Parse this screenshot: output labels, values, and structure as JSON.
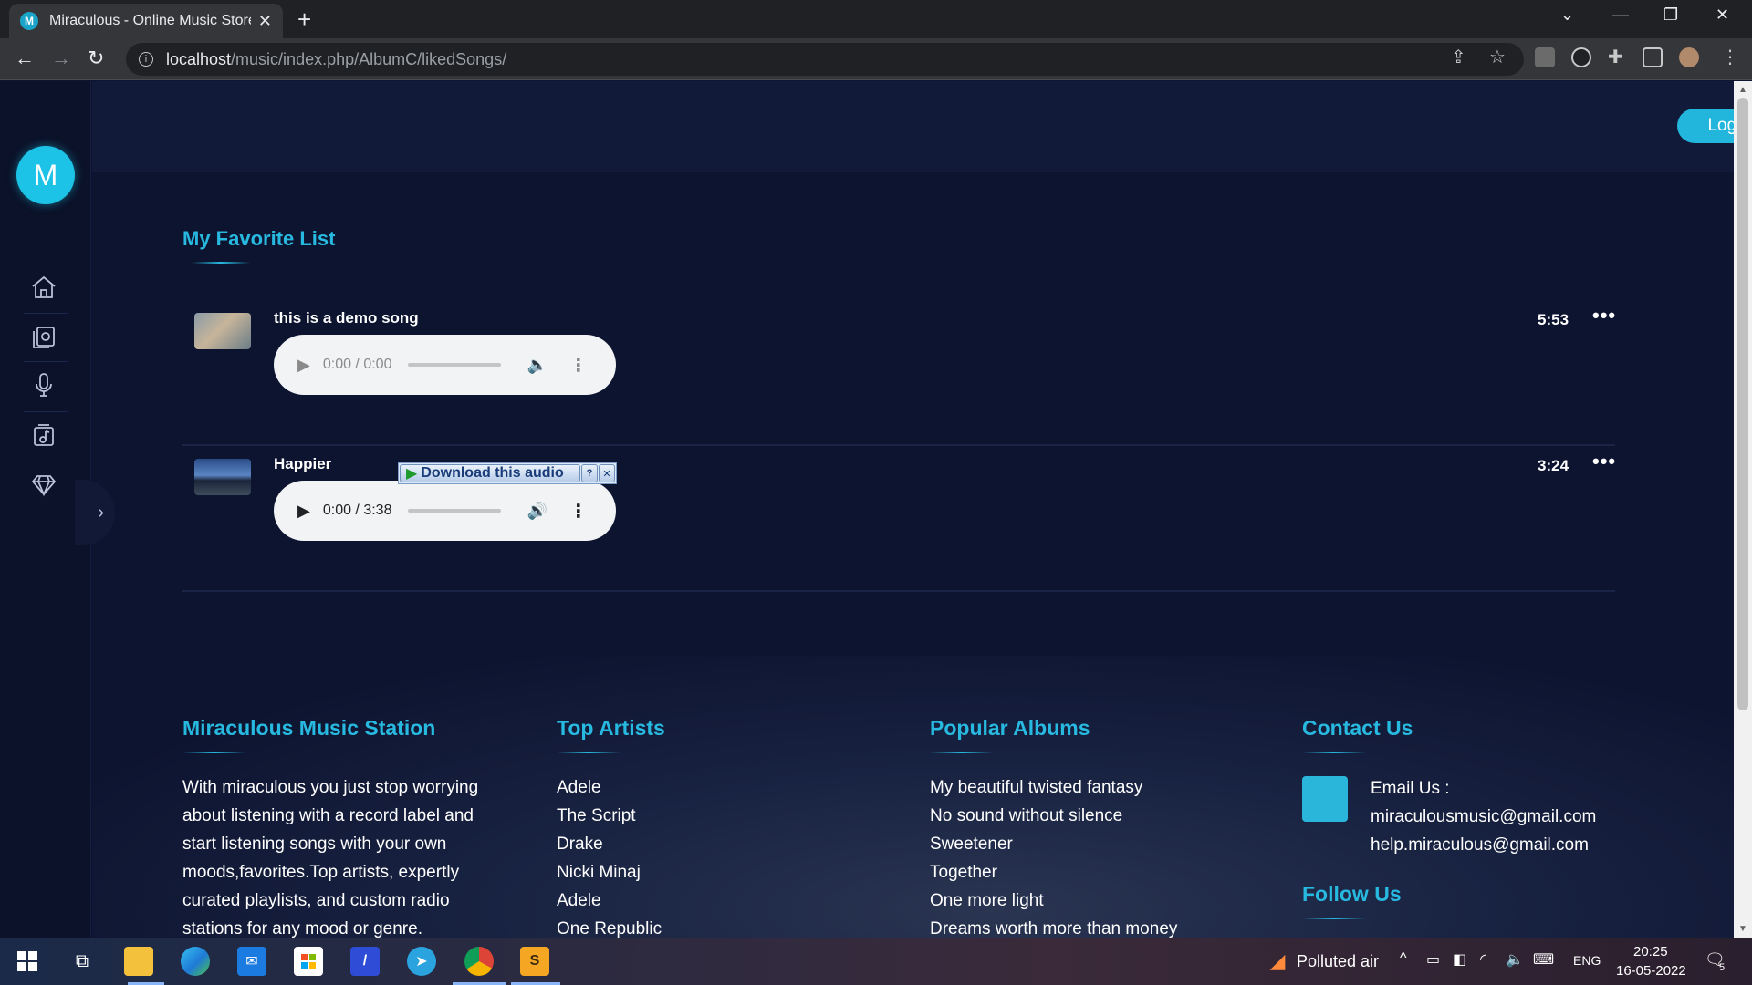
{
  "browser": {
    "tab_title": "Miraculous - Online Music Store",
    "tab_favicon_letter": "M",
    "url_host": "localhost",
    "url_path": "/music/index.php/AlbumC/likedSongs/"
  },
  "header": {
    "logout_label": "Logout"
  },
  "sidebar": {
    "logo_letter": "M",
    "items": [
      {
        "icon": "home-icon"
      },
      {
        "icon": "albums-icon"
      },
      {
        "icon": "microphone-icon"
      },
      {
        "icon": "music-note-icon"
      },
      {
        "icon": "diamond-icon"
      }
    ]
  },
  "favorites": {
    "title": "My Favorite List",
    "songs": [
      {
        "name": "this is a demo song",
        "player_time": "0:00 / 0:00",
        "duration": "5:53",
        "menu": "•••"
      },
      {
        "name": "Happier",
        "player_time": "0:00 / 3:38",
        "duration": "3:24",
        "menu": "•••"
      }
    ],
    "download_label": "Download this audio"
  },
  "footer": {
    "about": {
      "heading": "Miraculous Music Station",
      "text": "With miraculous you just stop worrying about listening with a record label and start listening songs with your own moods,favorites.Top artists, expertly curated playlists, and custom radio stations for any mood or genre."
    },
    "artists": {
      "heading": "Top Artists",
      "items": [
        "Adele",
        "The Script",
        "Drake",
        "Nicki Minaj",
        "Adele",
        "One Republic"
      ]
    },
    "albums": {
      "heading": "Popular Albums",
      "items": [
        "My beautiful twisted fantasy",
        "No sound without silence",
        "Sweetener",
        "Together",
        "One more light",
        "Dreams worth more than money"
      ]
    },
    "contact": {
      "heading": "Contact Us",
      "email_label": "Email Us :",
      "emails": [
        "miraculousmusic@gmail.com",
        "help.miraculous@gmail.com"
      ],
      "follow_heading": "Follow Us"
    }
  },
  "taskbar": {
    "weather": "Polluted air",
    "language": "ENG",
    "time": "20:25",
    "date": "16-05-2022",
    "notifications": "5"
  },
  "colors": {
    "accent": "#28b9e0",
    "page_bg": "#0d1430",
    "header_bg": "#121a3a"
  }
}
